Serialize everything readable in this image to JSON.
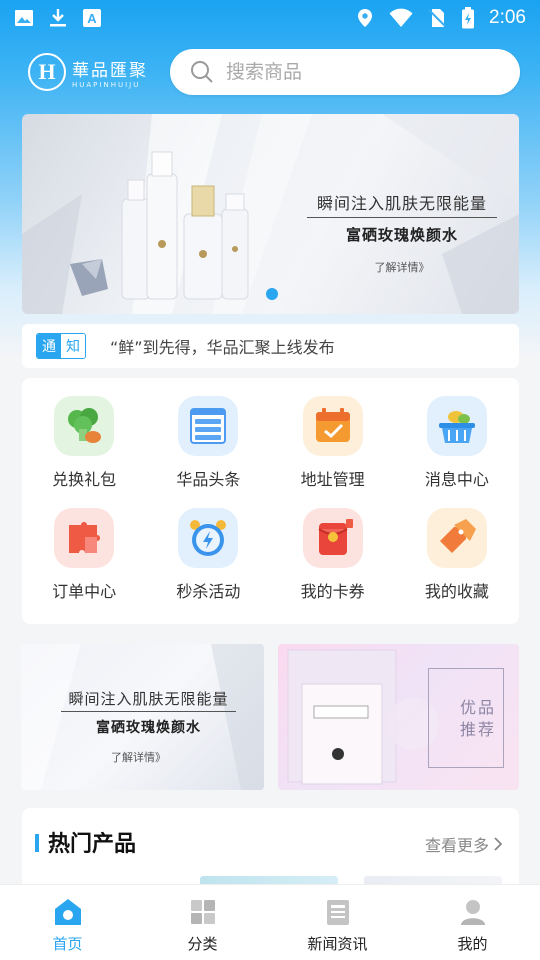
{
  "status_bar": {
    "time": "2:06",
    "left_icons": [
      "image-icon",
      "download-icon",
      "keyboard-icon"
    ],
    "right_icons": [
      "location-icon",
      "wifi-icon",
      "no-sim-icon",
      "battery-icon"
    ]
  },
  "header": {
    "logo_mark": "H",
    "logo_cn": "華品匯聚",
    "logo_en": "HUAPINHUIJU",
    "search_placeholder": "搜索商品"
  },
  "banner": {
    "headline": "瞬间注入肌肤无限能量",
    "product": "富硒玫瑰焕颜水",
    "more": "了解详情》"
  },
  "notice": {
    "tag_a": "通",
    "tag_b": "知",
    "text": "“鲜”到先得，华品汇聚上线发布"
  },
  "grid": {
    "items": [
      {
        "label": "兑换礼包",
        "icon": "gift-broccoli-icon"
      },
      {
        "label": "华品头条",
        "icon": "headline-list-icon"
      },
      {
        "label": "地址管理",
        "icon": "calendar-check-icon"
      },
      {
        "label": "消息中心",
        "icon": "basket-icon"
      },
      {
        "label": "订单中心",
        "icon": "puzzle-icon"
      },
      {
        "label": "秒杀活动",
        "icon": "alarm-clock-icon"
      },
      {
        "label": "我的卡券",
        "icon": "red-envelope-icon"
      },
      {
        "label": "我的收藏",
        "icon": "sale-tag-icon"
      }
    ]
  },
  "promo": {
    "left_headline": "瞬间注入肌肤无限能量",
    "left_product": "富硒玫瑰焕颜水",
    "left_more": "了解详情》",
    "right_chars": [
      "优",
      "品",
      "推",
      "荐"
    ]
  },
  "hot": {
    "title": "热门产品",
    "more": "查看更多"
  },
  "tabbar": {
    "tabs": [
      {
        "label": "首页",
        "icon": "home-icon"
      },
      {
        "label": "分类",
        "icon": "category-icon"
      },
      {
        "label": "新闻资讯",
        "icon": "news-icon"
      },
      {
        "label": "我的",
        "icon": "profile-icon"
      }
    ]
  },
  "colors": {
    "accent": "#2aa6f0",
    "header_gradient_top": "#1aa3f2"
  }
}
